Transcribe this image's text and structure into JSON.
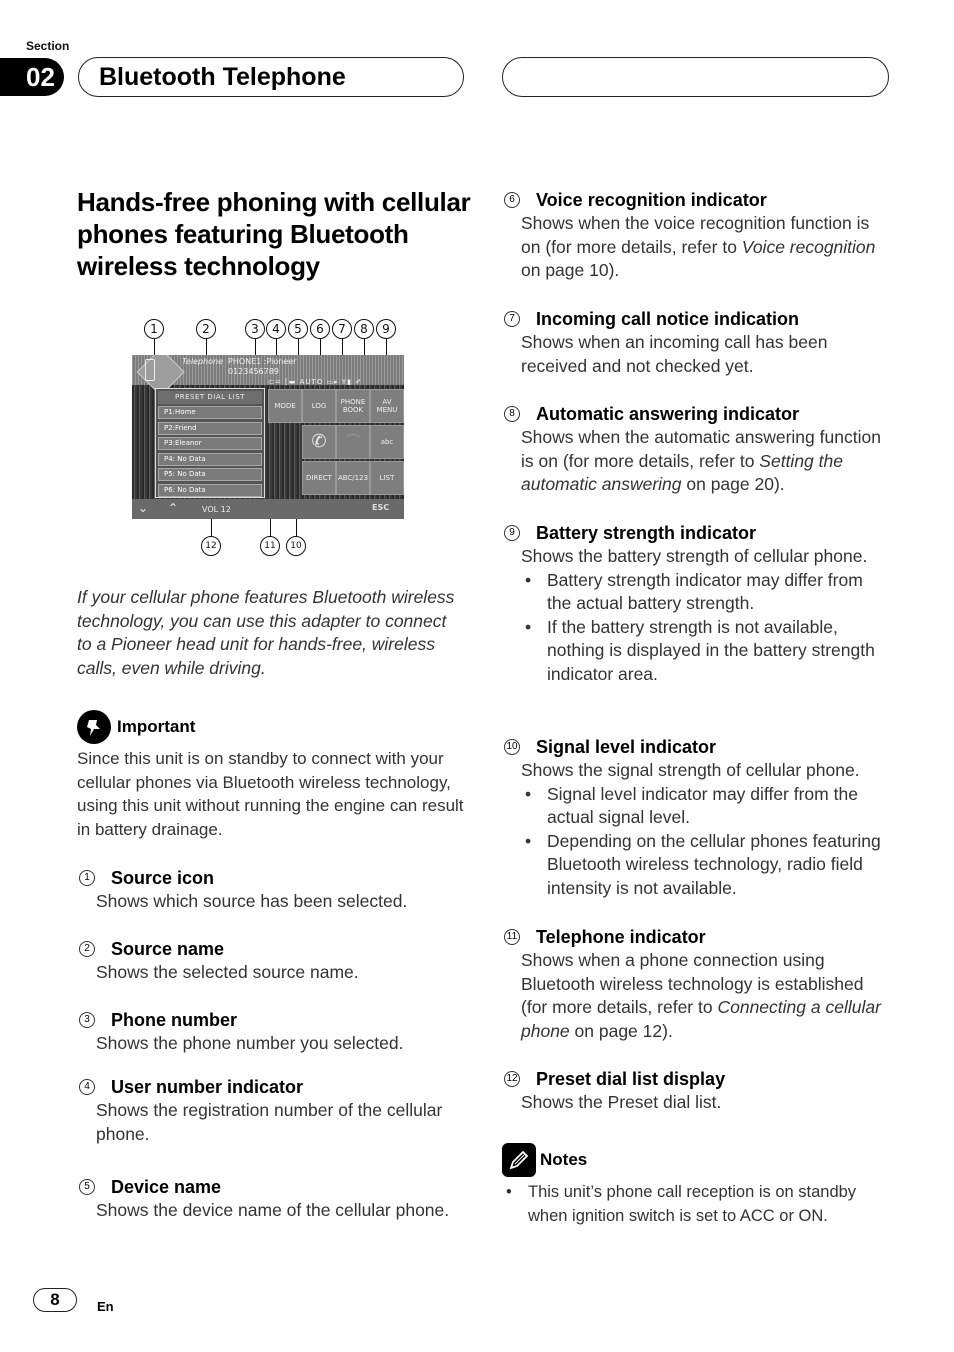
{
  "header": {
    "section_label": "Section",
    "section_number": "02",
    "section_title": "Bluetooth Telephone"
  },
  "heading": "Hands-free phoning with cellular phones featuring Bluetooth wireless technology",
  "figure": {
    "callouts": [
      "1",
      "2",
      "3",
      "4",
      "5",
      "6",
      "7",
      "8",
      "9",
      "10",
      "11",
      "12"
    ],
    "screen": {
      "source_name": "Telephone",
      "phone_label": "PHONE1 :Pioneer",
      "phone_number": "0123456789",
      "status_icons": [
        "telephone-indicator",
        "signal-level",
        "AUTO",
        "incoming-call",
        "auto-answer",
        "battery"
      ],
      "auto_label": "AUTO",
      "preset_title": "PRESET DIAL LIST",
      "preset_rows": [
        "P1:Home",
        "P2:Friend",
        "P3:Eleanor",
        "P4:  No Data",
        "P5:  No Data",
        "P6:  No Data"
      ],
      "buttons": [
        "MODE",
        "LOG",
        "PHONE BOOK",
        "AV MENU",
        "",
        "",
        "abc",
        "DIRECT",
        "ABC/123",
        "LIST"
      ],
      "volume_label": "VOL 12",
      "esc_label": "ESC"
    }
  },
  "intro": "If your cellular phone features Bluetooth wireless technology, you can use this adapter to connect to a Pioneer head unit for hands-free, wireless calls, even while driving.",
  "important": {
    "title": "Important",
    "text": "Since this unit is on standby to connect with your cellular phones via Bluetooth wireless technology, using this unit without running the engine can result in battery drainage."
  },
  "items": [
    {
      "num": "1",
      "title": "Source icon",
      "desc": "Shows which source has been selected."
    },
    {
      "num": "2",
      "title": "Source name",
      "desc": "Shows the selected source name."
    },
    {
      "num": "3",
      "title": "Phone number",
      "desc": "Shows the phone number you selected."
    },
    {
      "num": "4",
      "title": "User number indicator",
      "desc": "Shows the registration number of the cellular phone."
    },
    {
      "num": "5",
      "title": "Device name",
      "desc": "Shows the device name of the cellular phone."
    },
    {
      "num": "6",
      "title": "Voice recognition indicator",
      "desc_pre": "Shows when the voice recognition function is on (for more details, refer to ",
      "desc_link": "Voice recognition",
      "desc_post": " on page 10)."
    },
    {
      "num": "7",
      "title": "Incoming call notice indication",
      "desc": "Shows when an incoming call has been received and not checked yet."
    },
    {
      "num": "8",
      "title": "Automatic answering indicator",
      "desc_pre": "Shows when the automatic answering function is on (for more details, refer to ",
      "desc_link": "Setting the automatic answering",
      "desc_post": " on page 20)."
    },
    {
      "num": "9",
      "title": "Battery strength indicator",
      "desc": "Shows the battery strength of cellular phone.",
      "bullets": [
        "Battery strength indicator may differ from the actual battery strength.",
        "If the battery strength is not available, nothing is displayed in the battery strength indicator area."
      ]
    },
    {
      "num": "10",
      "title": "Signal level indicator",
      "desc": "Shows the signal strength of cellular phone.",
      "bullets": [
        "Signal level indicator may differ from the actual signal level.",
        "Depending on the cellular phones featuring Bluetooth wireless technology, radio field intensity is not available."
      ]
    },
    {
      "num": "11",
      "title": "Telephone indicator",
      "desc_pre": "Shows when a phone connection using Bluetooth wireless technology is established (for more details, refer to ",
      "desc_link": "Connecting a cellular phone",
      "desc_post": " on page 12)."
    },
    {
      "num": "12",
      "title": "Preset dial list display",
      "desc": "Shows the Preset dial list."
    }
  ],
  "notes": {
    "title": "Notes",
    "bullets": [
      "This unit’s phone call reception is on standby when ignition switch is set to ACC or ON."
    ]
  },
  "footer": {
    "page_number": "8",
    "language": "En"
  }
}
